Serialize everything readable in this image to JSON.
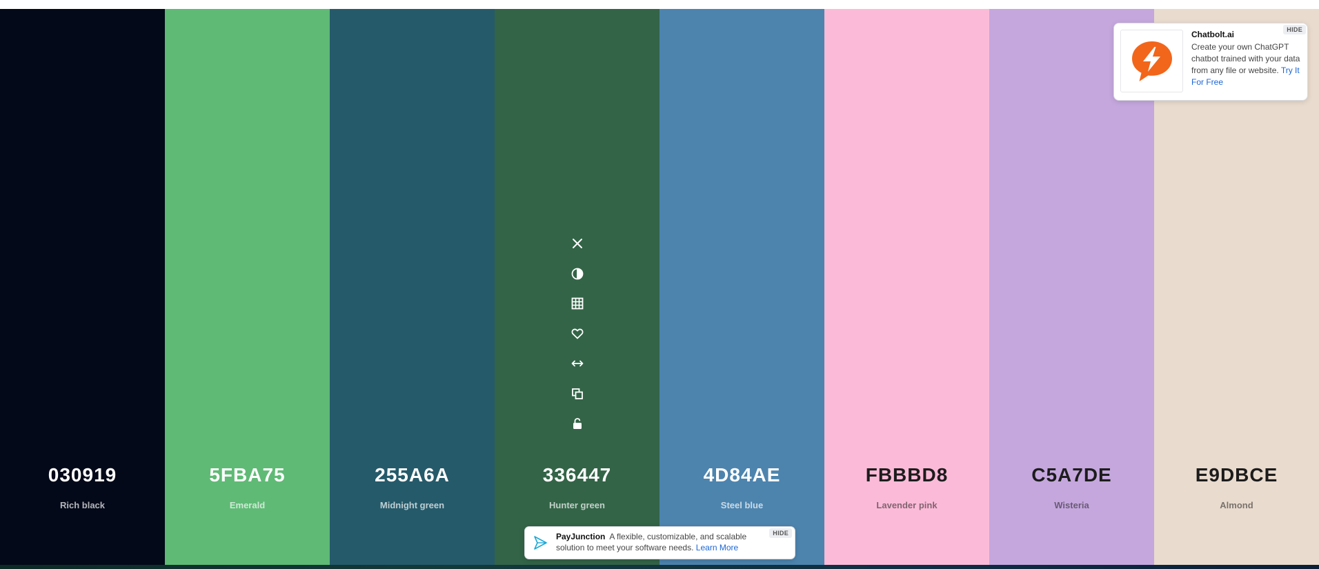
{
  "palette": [
    {
      "hex": "030919",
      "name": "Rich black",
      "color": "#030919",
      "text": "light"
    },
    {
      "hex": "5FBA75",
      "name": "Emerald",
      "color": "#5FBA75",
      "text": "light"
    },
    {
      "hex": "255A6A",
      "name": "Midnight green",
      "color": "#255A6A",
      "text": "light"
    },
    {
      "hex": "336447",
      "name": "Hunter green",
      "color": "#336447",
      "text": "light"
    },
    {
      "hex": "4D84AE",
      "name": "Steel blue",
      "color": "#4D84AE",
      "text": "light"
    },
    {
      "hex": "FBBBD8",
      "name": "Lavender pink",
      "color": "#FBBBD8",
      "text": "dark"
    },
    {
      "hex": "C5A7DE",
      "name": "Wisteria",
      "color": "#C5A7DE",
      "text": "dark"
    },
    {
      "hex": "E9DBCE",
      "name": "Almond",
      "color": "#E9DBCE",
      "text": "dark"
    }
  ],
  "hovered_swatch_tools": [
    "close-icon",
    "shades-icon",
    "grid-icon",
    "heart-icon",
    "drag-icon",
    "copy-icon",
    "unlock-icon"
  ],
  "ad_top": {
    "brand": "Chatbolt.ai",
    "body": "Create your own ChatGPT chatbot trained with your data from any file or website.",
    "link": "Try It For Free",
    "hide_label": "HIDE",
    "brand_color": "#F2661B"
  },
  "ad_bottom": {
    "brand": "PayJunction",
    "body": "A flexible, customizable, and scalable solution to meet your software needs.",
    "link": "Learn More",
    "hide_label": "HIDE",
    "brand_color": "#1BA9D6"
  }
}
